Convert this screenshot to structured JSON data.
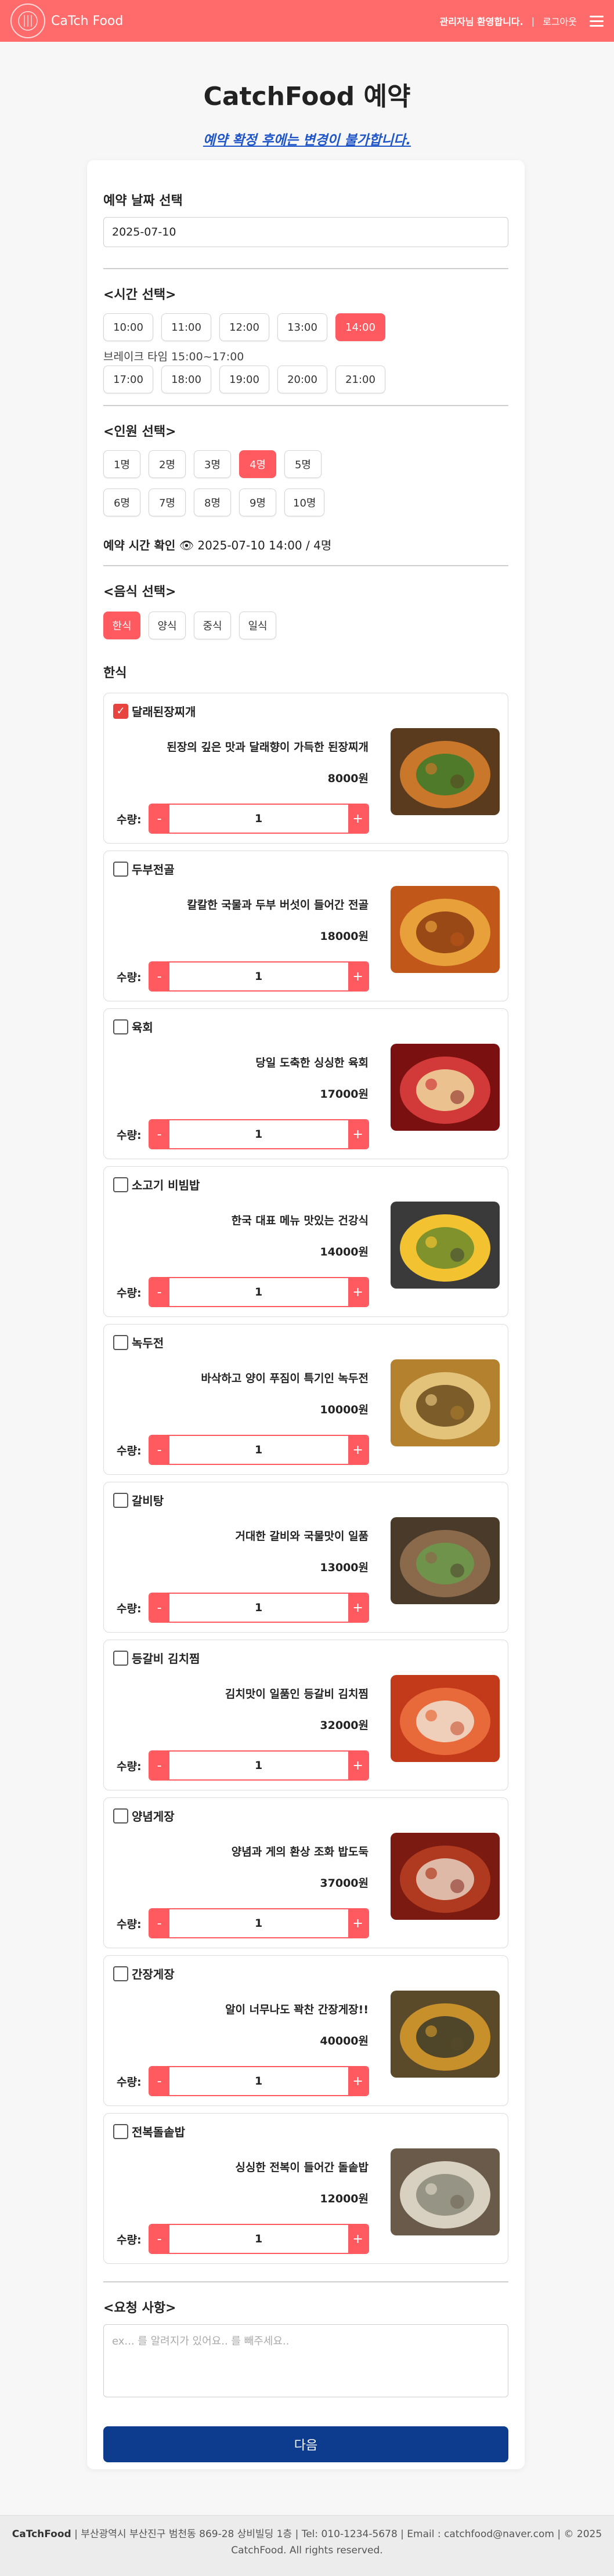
{
  "header": {
    "brand": "CaTch Food",
    "welcome": "관리자님 환영합니다.",
    "separator": "|",
    "logout": "로그아웃"
  },
  "page": {
    "title": "CatchFood 예약",
    "notice": "예약 확정 후에는 변경이 불가합니다."
  },
  "date": {
    "label": "예약 날짜 선택",
    "value": "2025-07-10"
  },
  "time": {
    "label": "<시간 선택>",
    "slots_am": [
      "10:00",
      "11:00",
      "12:00",
      "13:00",
      "14:00"
    ],
    "break_text": "브레이크 타임 15:00~17:00",
    "slots_pm": [
      "17:00",
      "18:00",
      "19:00",
      "20:00",
      "21:00"
    ],
    "selected": "14:00"
  },
  "people": {
    "label": "<인원 선택>",
    "options_row1": [
      "1명",
      "2명",
      "3명",
      "4명",
      "5명"
    ],
    "options_row2": [
      "6명",
      "7명",
      "8명",
      "9명",
      "10명"
    ],
    "selected": "4명"
  },
  "confirm": {
    "label": "예약 시간 확인",
    "value": "👁 2025-07-10 14:00 / 4명"
  },
  "food": {
    "label": "<음식 선택>",
    "categories": [
      "한식",
      "양식",
      "중식",
      "일식"
    ],
    "selected_category": "한식",
    "section_heading": "한식",
    "qty_label": "수량:",
    "minus": "-",
    "plus": "+",
    "items": [
      {
        "name": "달래된장찌개",
        "desc": "된장의 깊은 맛과 달래향이 가득한 된장찌개",
        "price": "8000원",
        "qty": "1",
        "checked": true
      },
      {
        "name": "두부전골",
        "desc": "칼칼한 국물과 두부 버섯이 들어간 전골",
        "price": "18000원",
        "qty": "1",
        "checked": false
      },
      {
        "name": "육회",
        "desc": "당일 도축한 싱싱한 육회",
        "price": "17000원",
        "qty": "1",
        "checked": false
      },
      {
        "name": "소고기 비빔밥",
        "desc": "한국 대표 메뉴 맛있는 건강식",
        "price": "14000원",
        "qty": "1",
        "checked": false
      },
      {
        "name": "녹두전",
        "desc": "바삭하고 양이 푸짐이 특기인 녹두전",
        "price": "10000원",
        "qty": "1",
        "checked": false
      },
      {
        "name": "갈비탕",
        "desc": "거대한 갈비와 국물맛이 일품",
        "price": "13000원",
        "qty": "1",
        "checked": false
      },
      {
        "name": "등갈비 김치찜",
        "desc": "김치맛이 일품인 등갈비 김치찜",
        "price": "32000원",
        "qty": "1",
        "checked": false
      },
      {
        "name": "양념게장",
        "desc": "양념과 게의 환상 조화 밥도둑",
        "price": "37000원",
        "qty": "1",
        "checked": false
      },
      {
        "name": "간장게장",
        "desc": "알이 너무나도 꽉찬 간장게장!!",
        "price": "40000원",
        "qty": "1",
        "checked": false
      },
      {
        "name": "전복돌솥밥",
        "desc": "싱싱한 전복이 들어간 돌솥밥",
        "price": "12000원",
        "qty": "1",
        "checked": false
      }
    ]
  },
  "request": {
    "label": "<요청 사항>",
    "placeholder": "ex... 를 알려지가 있어요.. 를 빼주세요.."
  },
  "next_button": "다음",
  "footer": {
    "brand": "CaTchFood",
    "line1": " | 부산광역시 부산진구 범천동 869-28 상비빌딩 1층 | Tel: 010-1234-5678 | Email : catchfood@naver.com | © 2025",
    "line2": "CatchFood. All rights reserved."
  },
  "colors": {
    "header_bg": "#ff6b6b",
    "accent": "#ff5a5f",
    "notice": "#1e55c8",
    "next_button": "#0d3b8e"
  }
}
